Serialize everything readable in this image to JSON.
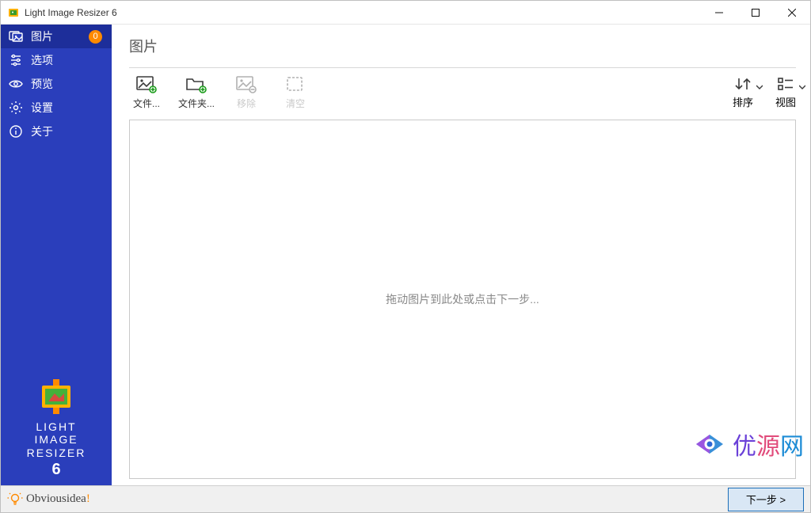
{
  "window": {
    "title": "Light Image Resizer 6"
  },
  "sidebar": {
    "items": [
      {
        "label": "图片",
        "badge": "0"
      },
      {
        "label": "选项"
      },
      {
        "label": "预览"
      },
      {
        "label": "设置"
      },
      {
        "label": "关于"
      }
    ],
    "brand": {
      "line1": "LIGHT",
      "line2": "IMAGE",
      "line3": "RESIZER",
      "line4": "6"
    }
  },
  "content": {
    "title": "图片",
    "toolbar": {
      "file": "文件...",
      "folder": "文件夹...",
      "remove": "移除",
      "clear": "清空",
      "sort": "排序",
      "view": "视图"
    },
    "hint": "拖动图片到此处或点击下一步..."
  },
  "footer": {
    "brand": "Obviousidea",
    "bang": "!",
    "next": "下一步 >"
  },
  "watermark": {
    "c1": "优",
    "c2": "源",
    "c3": "网"
  }
}
